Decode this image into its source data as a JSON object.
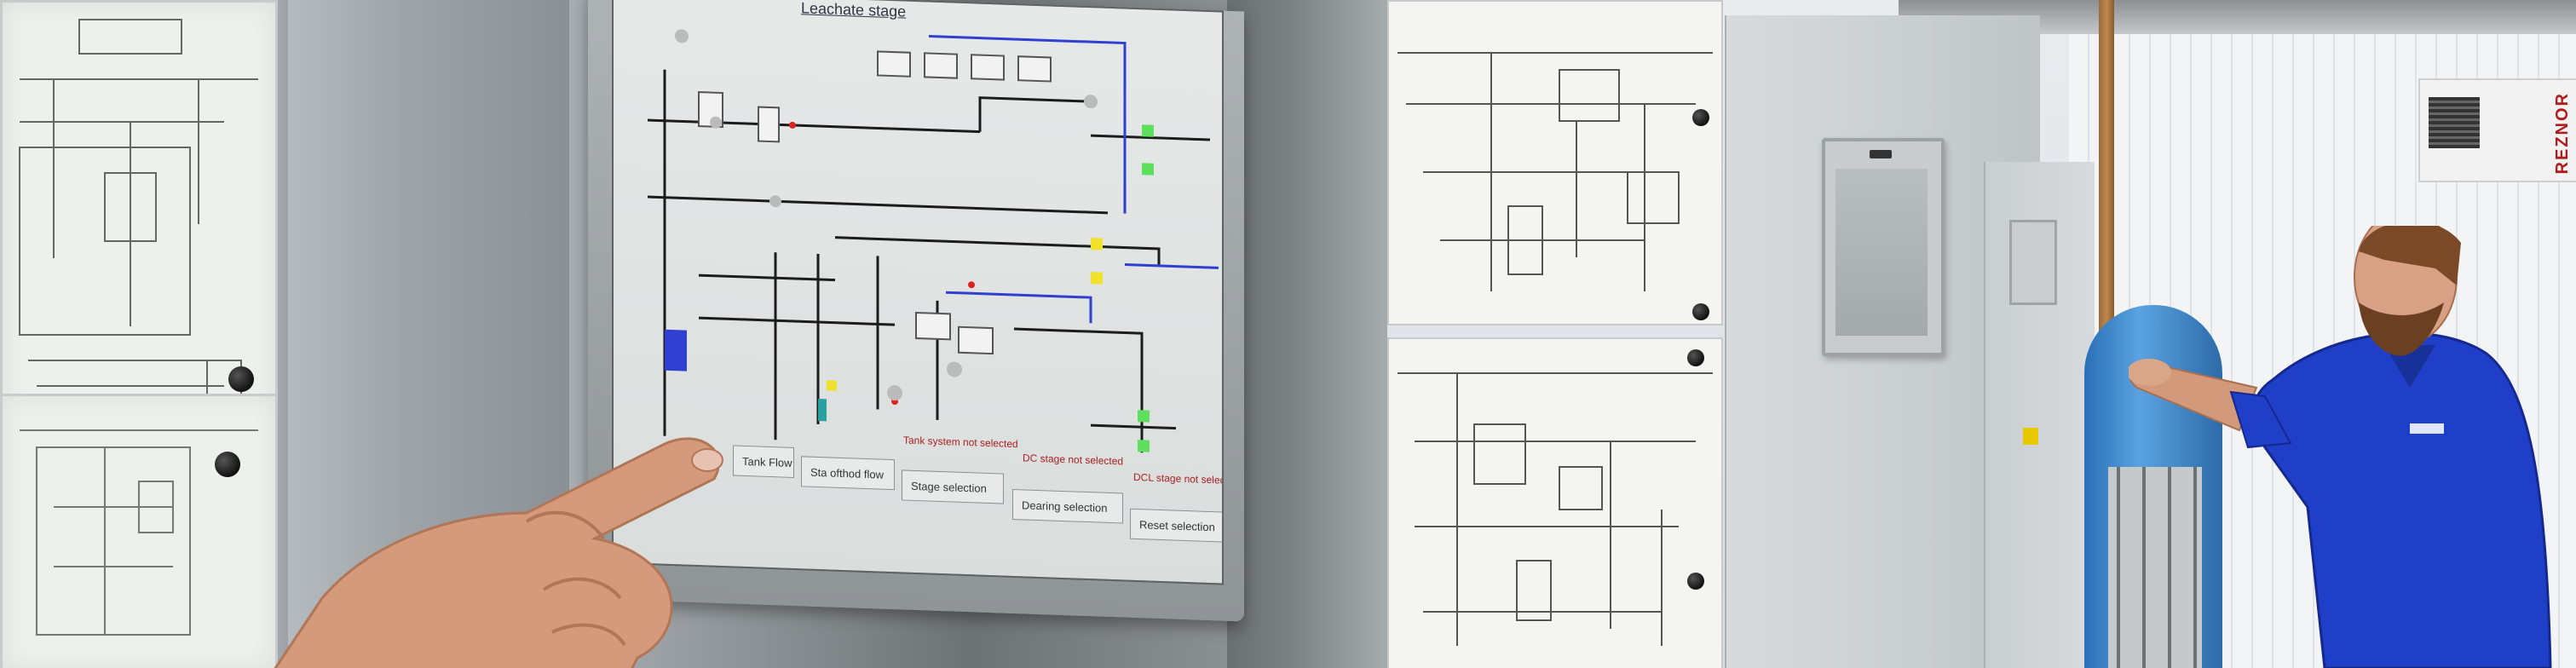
{
  "screen": {
    "title": "Leachate stage",
    "buttons": [
      "Tank Flow",
      "Sta ofthod flow",
      "Stage selection",
      "Dearing selection",
      "Reset selection"
    ],
    "status_messages": [
      "Tank system not selected",
      "DC stage not selected",
      "DCL stage not selected"
    ]
  },
  "heater": {
    "brand": "REZNOR"
  },
  "colors": {
    "screen_bg": "#dfe2e1",
    "pipe_black": "#1c1c1c",
    "pipe_blue": "#2f3fd0",
    "valve_green": "#5ee05e",
    "valve_yellow": "#f0e12a",
    "shirt_blue": "#1f3fc9",
    "tank_blue": "#3a88d0"
  }
}
